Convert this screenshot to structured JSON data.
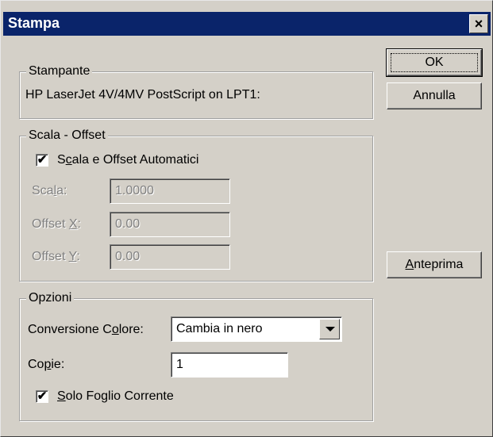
{
  "window": {
    "title": "Stampa",
    "close_label": "×"
  },
  "stampante": {
    "group_label": "Stampante",
    "printer_name": "HP LaserJet 4V/4MV PostScript on LPT1:"
  },
  "scala_offset": {
    "group_label": "Scala  - Offset",
    "auto_checkbox": {
      "checked": true,
      "check_mark": "✔",
      "label_pre": "S",
      "label_accel": "c",
      "label_post": "ala e Offset Automatici"
    },
    "scala": {
      "label_pre": "Sca",
      "label_accel": "l",
      "label_post": "a:",
      "value": "1.0000"
    },
    "offset_x": {
      "label_pre": "Offset ",
      "label_accel": "X",
      "label_post": ":",
      "value": "0.00"
    },
    "offset_y": {
      "label_pre": "Offset ",
      "label_accel": "Y",
      "label_post": ":",
      "value": "0.00"
    }
  },
  "opzioni": {
    "group_label": "Opzioni",
    "conversione": {
      "label_pre": "Conversione C",
      "label_accel": "o",
      "label_post": "lore:",
      "selected": "Cambia in nero"
    },
    "copie": {
      "label_pre": "Co",
      "label_accel": "p",
      "label_post": "ie:",
      "value": "1"
    },
    "solo_foglio": {
      "checked": true,
      "check_mark": "✔",
      "label_accel": "S",
      "label_post": "olo Foglio Corrente"
    }
  },
  "buttons": {
    "ok": "OK",
    "annulla": "Annulla",
    "anteprima_accel": "A",
    "anteprima_post": "nteprima"
  }
}
